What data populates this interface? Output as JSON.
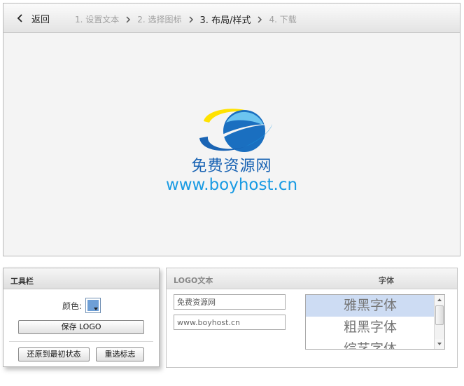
{
  "nav": {
    "back_label": "返回",
    "steps": [
      {
        "label": "1. 设置文本",
        "active": false
      },
      {
        "label": "2. 选择图标",
        "active": false
      },
      {
        "label": "3. 布局/样式",
        "active": true
      },
      {
        "label": "4. 下载",
        "active": false
      }
    ]
  },
  "preview": {
    "logo_text": "免费资源网",
    "logo_url": "www.boyhost.cn",
    "colors": {
      "dark_blue": "#1a64b4",
      "light_blue": "#1a9be3",
      "yellow": "#ffe200",
      "background": "#f4f4f4"
    }
  },
  "toolbar": {
    "title": "工具栏",
    "color_label": "颜色:",
    "color_value": "#6e9fd6",
    "save_button": "保存 LOGO",
    "reset_button": "还原到最初状态",
    "reselect_button": "重选标志"
  },
  "text_panel": {
    "title": "LOGO文本",
    "line1": "免费资源网",
    "line2": "www.boyhost.cn"
  },
  "font_panel": {
    "title": "字体",
    "fonts": [
      "雅黑字体",
      "粗黑字体",
      "综艺字体"
    ],
    "selected_index": 0
  }
}
